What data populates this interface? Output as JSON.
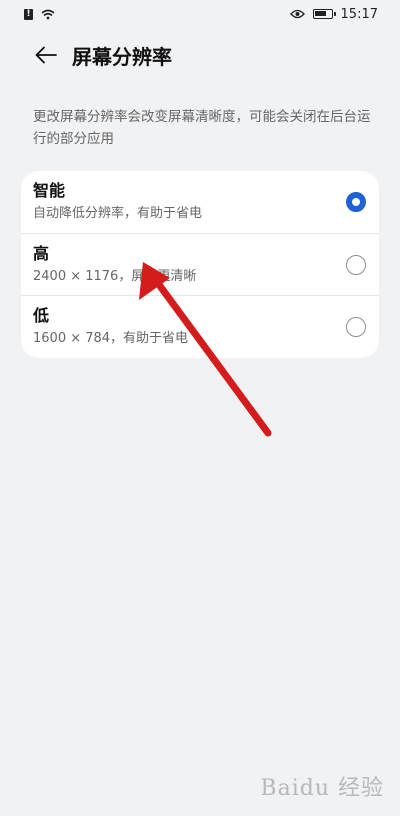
{
  "status_bar": {
    "time": "15:17",
    "left_icons": [
      "sim-alert-icon",
      "wifi-icon"
    ],
    "right_icons": [
      "eye-icon",
      "battery-icon"
    ]
  },
  "header": {
    "title": "屏幕分辨率",
    "back_icon": "back-arrow-icon"
  },
  "description": "更改屏幕分辨率会改变屏幕清晰度，可能会关闭在后台运行的部分应用",
  "options": [
    {
      "title": "智能",
      "subtitle": "自动降低分辨率，有助于省电",
      "selected": true
    },
    {
      "title": "高",
      "subtitle": "2400 × 1176，屏幕更清晰",
      "selected": false
    },
    {
      "title": "低",
      "subtitle": "1600 × 784，有助于省电",
      "selected": false
    }
  ],
  "colors": {
    "accent": "#1f62d6",
    "annotation_arrow": "#d51c1c",
    "background": "#f1f2f4"
  },
  "watermark": "Baidu 经验"
}
